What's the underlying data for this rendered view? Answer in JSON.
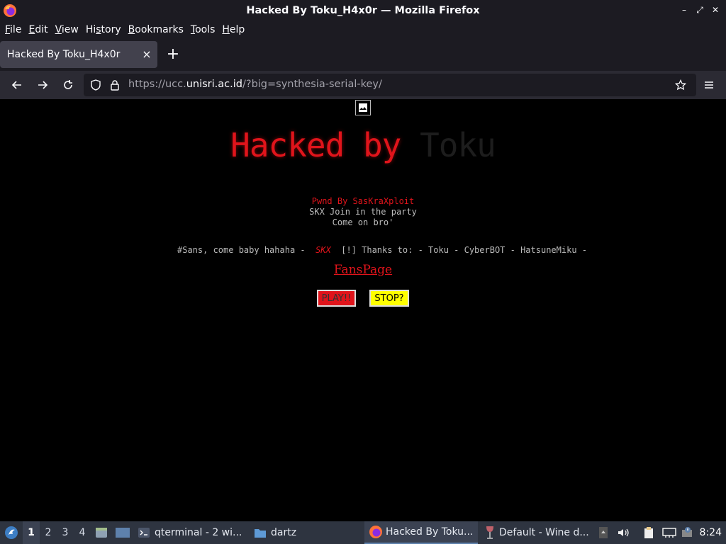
{
  "window": {
    "title": "Hacked By Toku_H4x0r — Mozilla Firefox"
  },
  "menu": [
    "File",
    "Edit",
    "View",
    "History",
    "Bookmarks",
    "Tools",
    "Help"
  ],
  "menu_underline": [
    "F",
    "E",
    "V",
    "s",
    "B",
    "T",
    "H"
  ],
  "tab": {
    "title": "Hacked By Toku_H4x0r",
    "close": "×",
    "new": "+"
  },
  "url": {
    "prefix": "https://ucc.",
    "host": "unisri.ac.id",
    "suffix": "/?big=synthesia-serial-key/"
  },
  "page": {
    "hacked_red": "Hacked by ",
    "hacked_dark": "Toku",
    "line1": "Pwnd By SasKraXploit",
    "line2": "SKX Join in the party",
    "line3": "Come on bro'",
    "thanks_left": "#Sans, come baby hahaha -  ",
    "thanks_skx": "SKX",
    "thanks_right": "  [!] Thanks to: - Toku - CyberBOT - HatsuneMiku -",
    "fanspage": "FansPage",
    "play": "PLAY!!",
    "stop": "STOP?"
  },
  "taskbar": {
    "workspaces": [
      "1",
      "2",
      "3",
      "4"
    ],
    "task_terminal": "qterminal - 2 wi...",
    "task_folder": "dartz",
    "task_firefox": "Hacked By Toku...",
    "task_wine": "Default - Wine d...",
    "clock": "8:24"
  },
  "colors": {
    "accent_red": "#e0141b",
    "play_bg": "#e0141b",
    "stop_bg": "#ffff00",
    "page_bg": "#000000"
  }
}
